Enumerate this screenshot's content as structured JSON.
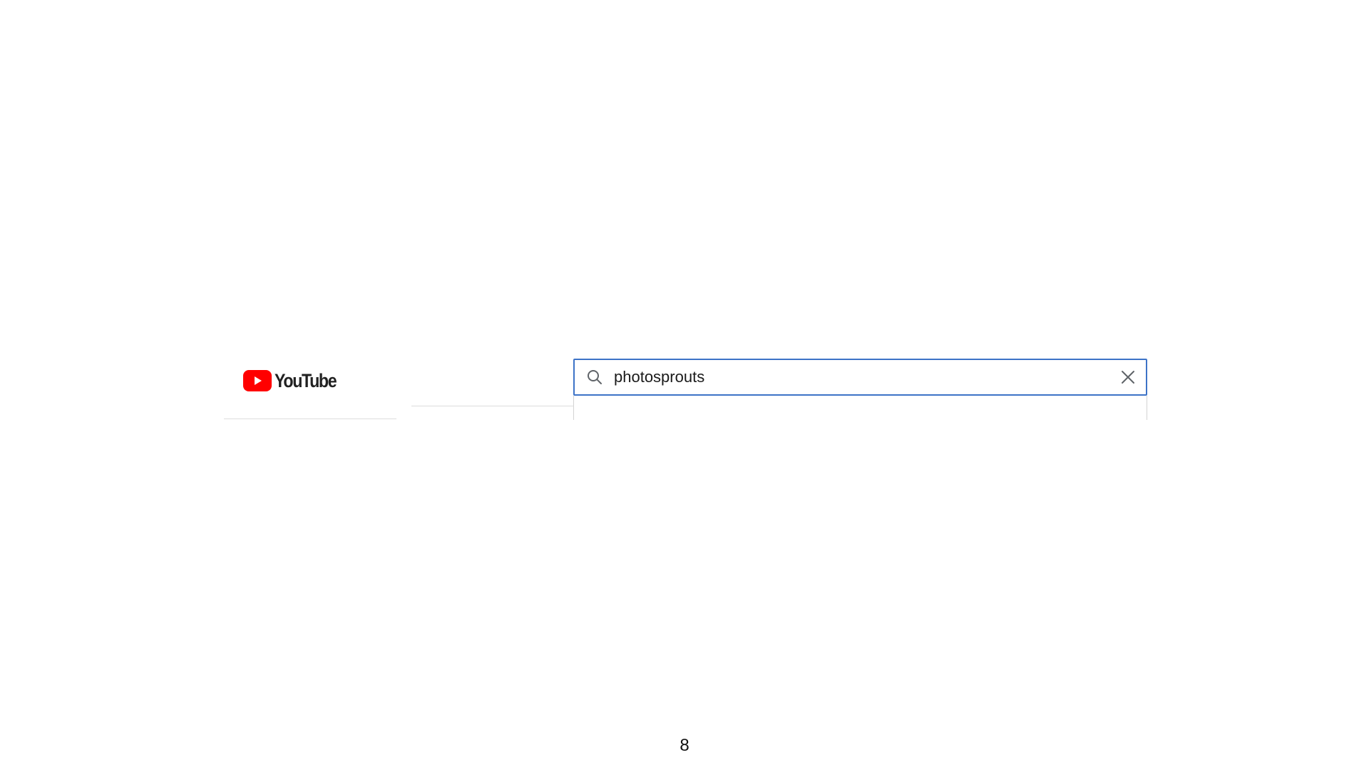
{
  "logo": {
    "text": "YouTube",
    "play_color": "#ff0000"
  },
  "search": {
    "value": "photosprouts",
    "border_color": "#3d73c7",
    "icon": "search-icon",
    "clear_icon": "close-icon"
  },
  "footer": {
    "page_number": "8"
  }
}
